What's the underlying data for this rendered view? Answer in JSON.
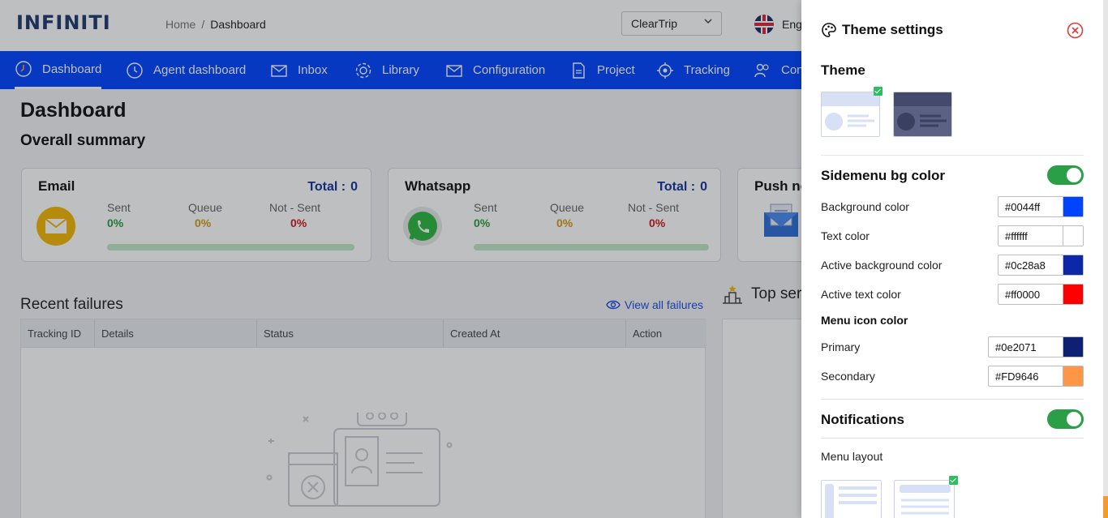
{
  "header": {
    "logo": "INFINITI",
    "breadcrumb": {
      "home": "Home",
      "separator": "/",
      "current": "Dashboard"
    },
    "org_select": {
      "value": "ClearTrip"
    },
    "language": "Eng"
  },
  "nav": {
    "items": [
      {
        "label": "Dashboard",
        "icon": "dashboard-icon",
        "active": true
      },
      {
        "label": "Agent dashboard",
        "icon": "agent-dashboard-icon"
      },
      {
        "label": "Inbox",
        "icon": "inbox-icon"
      },
      {
        "label": "Library",
        "icon": "library-gear-icon"
      },
      {
        "label": "Configuration",
        "icon": "configuration-icon"
      },
      {
        "label": "Project",
        "icon": "project-icon"
      },
      {
        "label": "Tracking",
        "icon": "tracking-icon"
      },
      {
        "label": "Con",
        "icon": "contacts-icon"
      }
    ]
  },
  "page": {
    "title": "Dashboard",
    "summary_title": "Overall summary"
  },
  "cards": [
    {
      "name": "Email",
      "total_label": "Total :",
      "total": "0",
      "sent_label": "Sent",
      "sent": "0%",
      "queue_label": "Queue",
      "queue": "0%",
      "notsent_label": "Not - Sent",
      "notsent": "0%"
    },
    {
      "name": "Whatsapp",
      "total_label": "Total :",
      "total": "0",
      "sent_label": "Sent",
      "sent": "0%",
      "queue_label": "Queue",
      "queue": "0%",
      "notsent_label": "Not - Sent",
      "notsent": "0%"
    },
    {
      "name": "Push no"
    }
  ],
  "failures": {
    "title": "Recent failures",
    "view_all": "View all failures",
    "columns": [
      "Tracking ID",
      "Details",
      "Status",
      "Created At",
      "Action"
    ]
  },
  "top_sender": {
    "label": "Top ser"
  },
  "drawer": {
    "title": "Theme settings",
    "theme_label": "Theme",
    "sidemenu_label": "Sidemenu bg color",
    "sidemenu_enabled": true,
    "colors": [
      {
        "label": "Background color",
        "value": "#0044ff",
        "swatch": "#0044ff"
      },
      {
        "label": "Text color",
        "value": "#ffffff",
        "swatch": "#ffffff"
      },
      {
        "label": "Active background color",
        "value": "#0c28a8",
        "swatch": "#0c28a8"
      },
      {
        "label": "Active text color",
        "value": "#ff0000",
        "swatch": "#ff0000"
      }
    ],
    "menu_icon_label": "Menu icon color",
    "icon_colors": [
      {
        "label": "Primary",
        "value": "#0e2071",
        "swatch": "#0e2071"
      },
      {
        "label": "Secondary",
        "value": "#FD9646",
        "swatch": "#FD9646"
      }
    ],
    "notifications_label": "Notifications",
    "notifications_enabled": true,
    "menu_layout_label": "Menu layout"
  }
}
